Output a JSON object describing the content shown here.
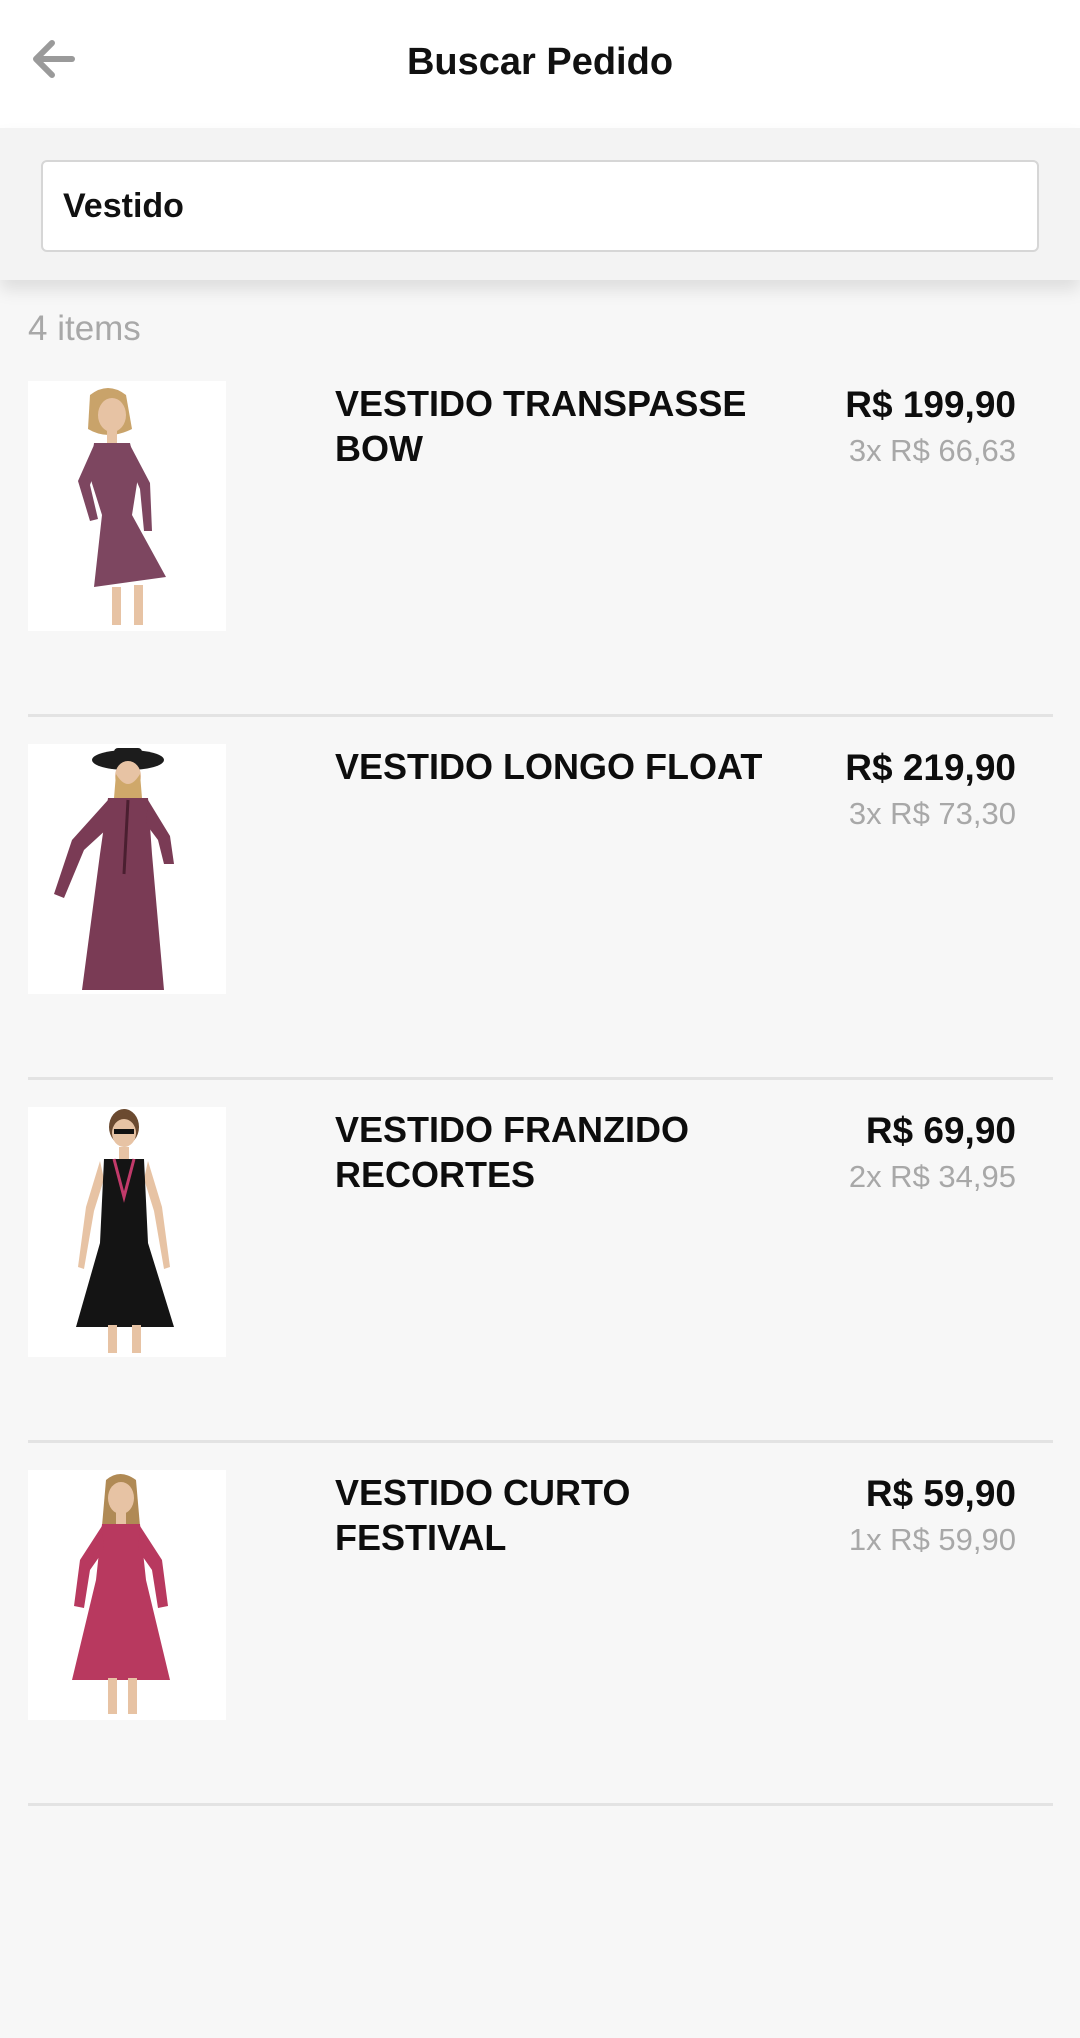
{
  "header": {
    "title": "Buscar Pedido",
    "back_icon": "arrow-left-icon"
  },
  "search": {
    "value": "Vestido"
  },
  "results": {
    "count_label": "4 items",
    "items": [
      {
        "name": "VESTIDO TRANSPASSE BOW",
        "price": "R$ 199,90",
        "installments": "3x R$ 66,63",
        "dress_color": "#7d4660"
      },
      {
        "name": "VESTIDO LONGO FLOAT",
        "price": "R$ 219,90",
        "installments": "3x R$ 73,30",
        "dress_color": "#7a3b55"
      },
      {
        "name": "VESTIDO FRANZIDO RECORTES",
        "price": "R$ 69,90",
        "installments": "2x R$ 34,95",
        "dress_color": "#141414"
      },
      {
        "name": "VESTIDO CURTO FESTIVAL",
        "price": "R$ 59,90",
        "installments": "1x R$ 59,90",
        "dress_color": "#b8395f"
      }
    ]
  },
  "colors": {
    "background": "#f7f7f7",
    "header": "#ffffff",
    "text_primary": "#111111",
    "text_muted": "#a8a8a8",
    "divider": "#e3e3e3"
  }
}
